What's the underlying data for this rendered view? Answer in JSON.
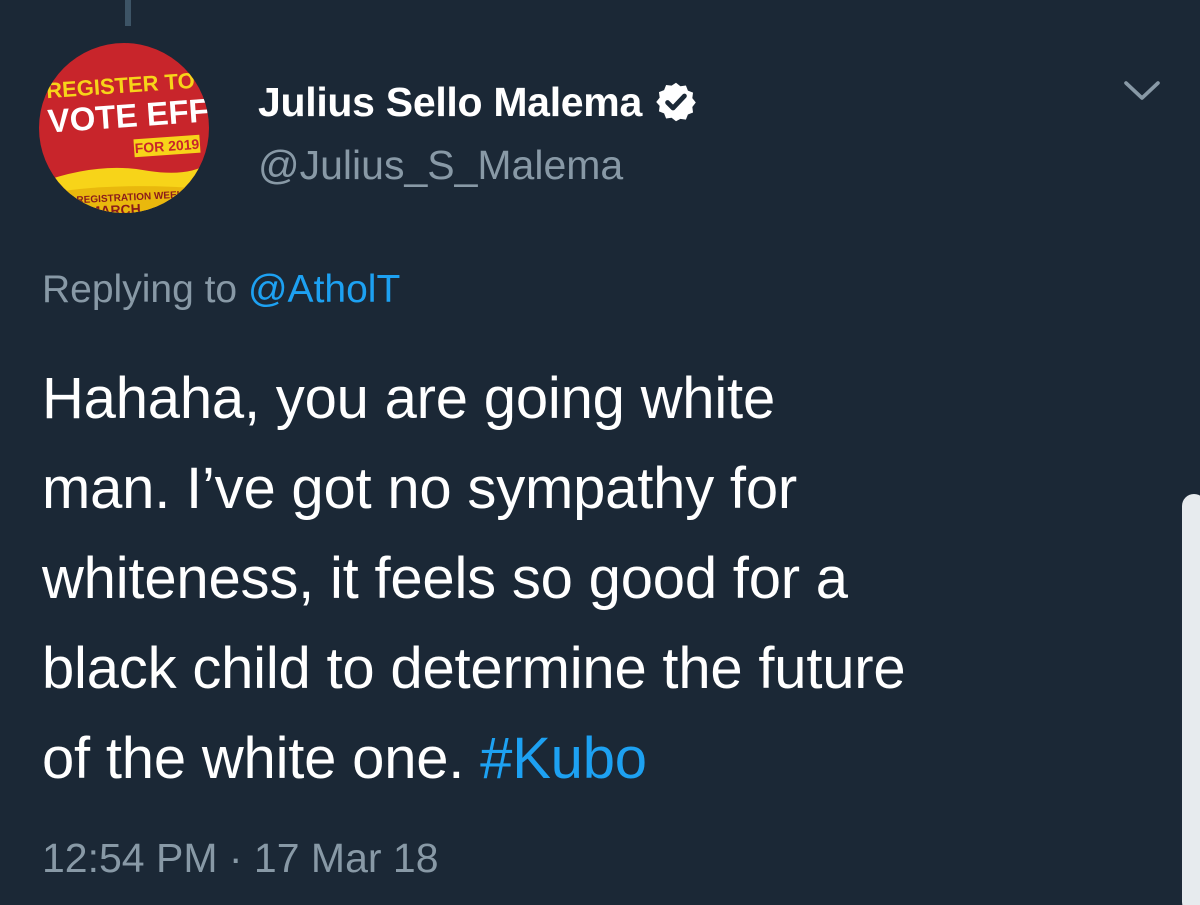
{
  "author": {
    "display_name": "Julius Sello Malema",
    "handle": "@Julius_S_Malema",
    "verified": true,
    "avatar": {
      "line1": "REGISTER TO",
      "line2": "VOTE EFF",
      "line3": "FOR 2019",
      "line4": "TER REGISTRATION WEEK",
      "line5": "MARCH"
    }
  },
  "reply": {
    "prefix": "Replying to",
    "mention": "@AtholT"
  },
  "tweet": {
    "lines": [
      "Hahaha, you are going white",
      "man. I’ve got no sympathy for",
      "whiteness, it feels so good for a",
      "black child to determine the future"
    ],
    "last_line_text": "of the white one. ",
    "hashtag": "#Kubo"
  },
  "timestamp": "12:54 PM · 17 Mar 18",
  "icons": {
    "verified": "verified-badge-icon",
    "menu": "chevron-down-icon"
  },
  "colors": {
    "background": "#1b2836",
    "accent": "#1da1f2",
    "muted": "#8899a6",
    "text": "#ffffff",
    "avatar_red": "#c8252b",
    "avatar_yellow": "#f7d419"
  }
}
